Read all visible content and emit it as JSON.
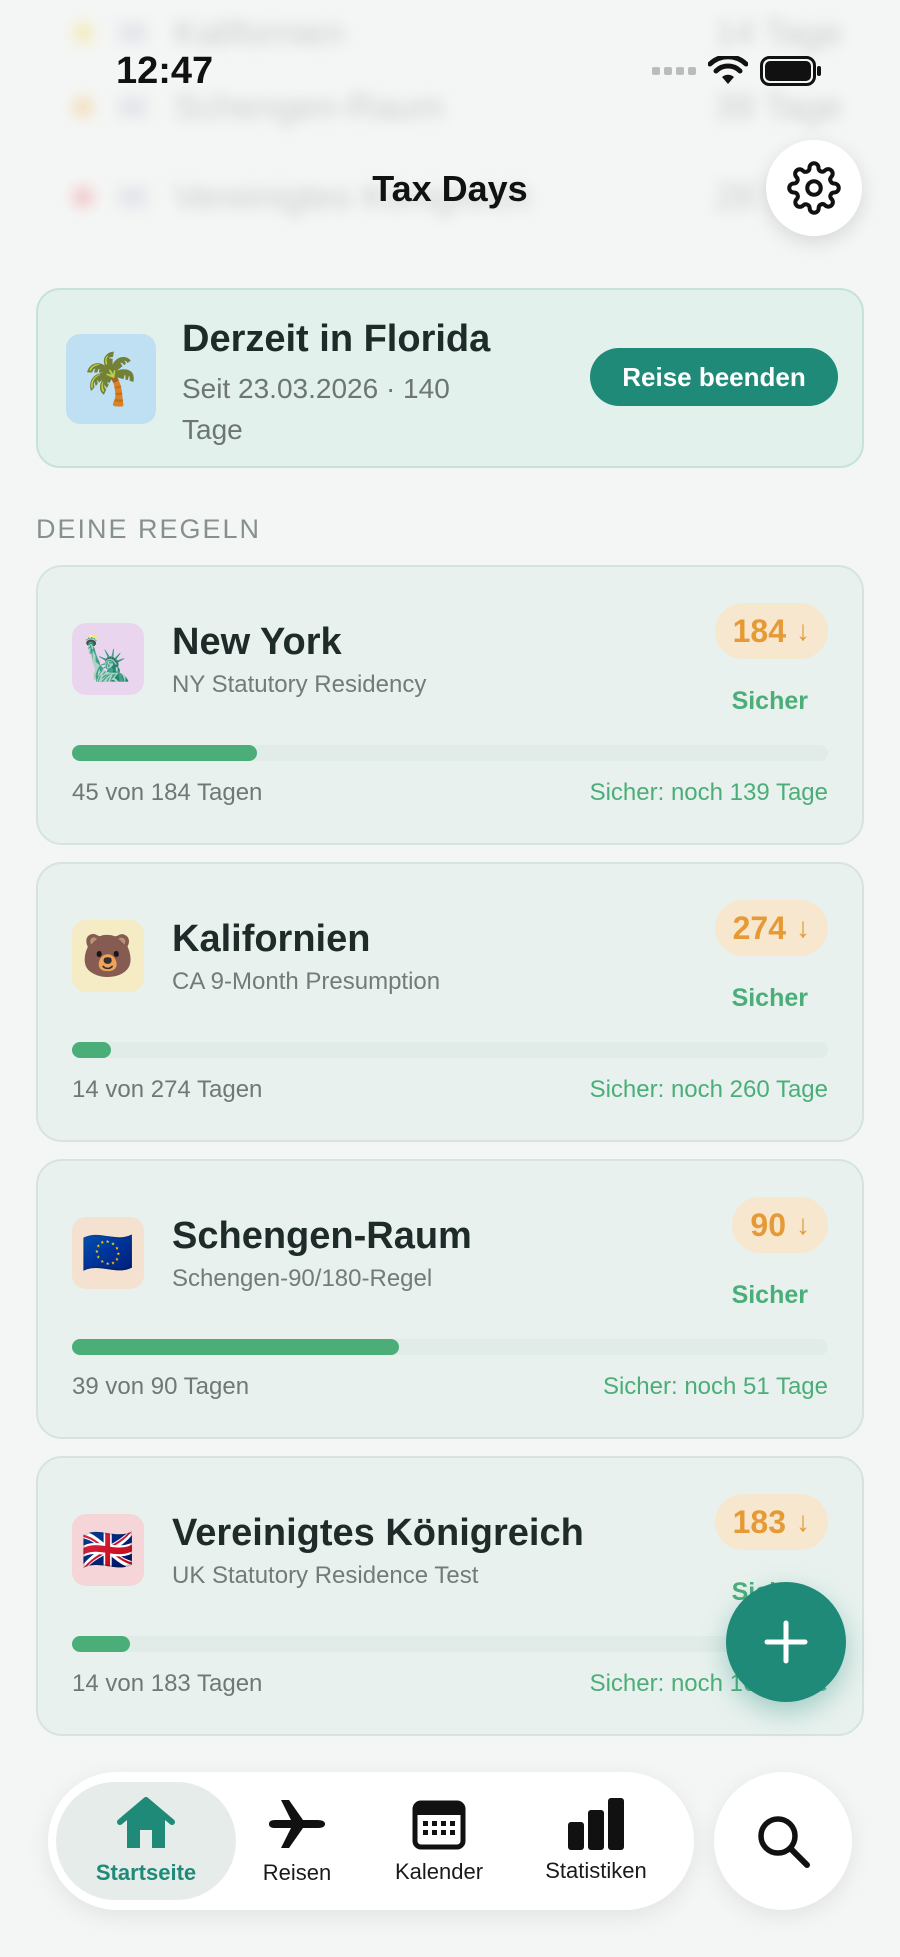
{
  "status_bar": {
    "time": "12:47"
  },
  "background_rows": [
    {
      "name": "Kalifornien",
      "value": "14 Tage",
      "dot": "#f3d75a"
    },
    {
      "name": "Schengen-Raum",
      "value": "39 Tage",
      "dot": "#f5b75a"
    },
    {
      "name": "Vereinigtes Königreich",
      "value": "28 Tage",
      "dot": "#f07880"
    }
  ],
  "header": {
    "title": "Tax Days"
  },
  "current": {
    "icon": "🌴",
    "title": "Derzeit in Florida",
    "subtitle": "Seit 23.03.2026 · 140 Tage",
    "end_button": "Reise beenden"
  },
  "rules_section": {
    "label": "DEINE REGELN"
  },
  "rules": [
    {
      "icon": "🗽",
      "icon_bg": "#ead5ef",
      "name": "New York",
      "desc": "NY Statutory Residency",
      "limit": "184",
      "status": "Sicher",
      "used_text": "45 von 184 Tagen",
      "left_text": "Sicher: noch 139 Tage",
      "progress": 0.245
    },
    {
      "icon": "🐻",
      "icon_bg": "#f5ecc5",
      "name": "Kalifornien",
      "desc": "CA 9-Month Presumption",
      "limit": "274",
      "status": "Sicher",
      "used_text": "14 von 274 Tagen",
      "left_text": "Sicher: noch 260 Tage",
      "progress": 0.051
    },
    {
      "icon": "🇪🇺",
      "icon_bg": "#f4e1d0",
      "name": "Schengen-Raum",
      "desc": "Schengen-90/180-Regel",
      "limit": "90",
      "status": "Sicher",
      "used_text": "39 von 90 Tagen",
      "left_text": "Sicher: noch 51 Tage",
      "progress": 0.433
    },
    {
      "icon": "🇬🇧",
      "icon_bg": "#f5d5d8",
      "name": "Vereinigtes Königreich",
      "desc": "UK Statutory Residence Test",
      "limit": "183",
      "status": "Sicher",
      "used_text": "14 von 183 Tagen",
      "left_text": "Sicher: noch 169 Tage",
      "progress": 0.077
    }
  ],
  "nav": {
    "tabs": [
      {
        "label": "Startseite",
        "icon": "home-icon"
      },
      {
        "label": "Reisen",
        "icon": "airplane-icon"
      },
      {
        "label": "Kalender",
        "icon": "calendar-icon"
      },
      {
        "label": "Statistiken",
        "icon": "bar-chart-icon"
      }
    ],
    "search_icon": "search-icon"
  },
  "colors": {
    "accent": "#1e8a77",
    "safe": "#4bae79",
    "limit_badge": "#e69a35"
  }
}
